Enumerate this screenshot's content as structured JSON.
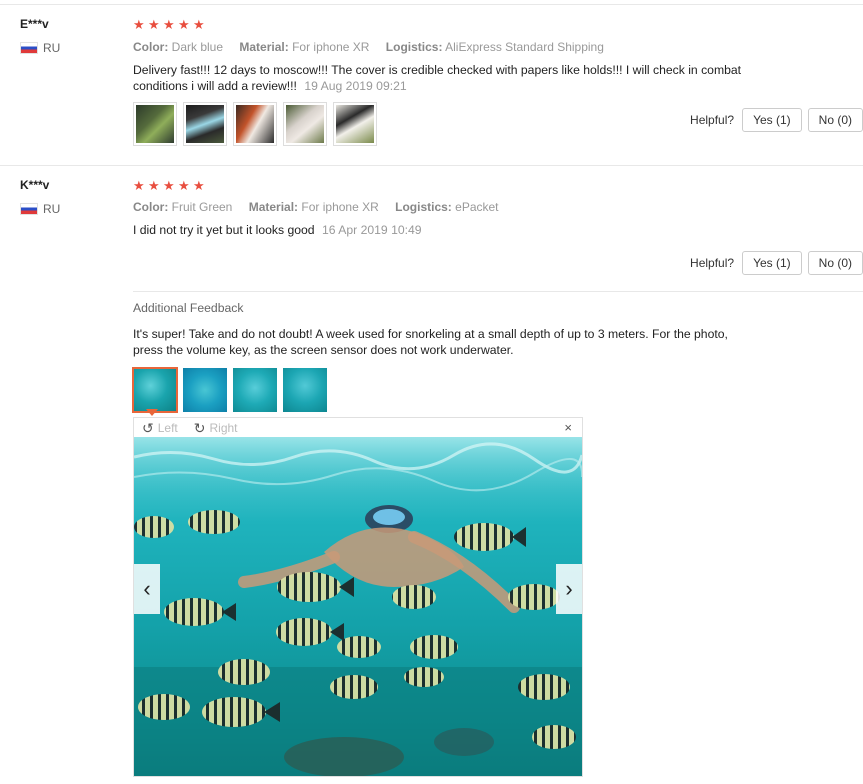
{
  "reviews": [
    {
      "user": "E***v",
      "country": "RU",
      "stars": 5,
      "attrs": {
        "color_label": "Color:",
        "color_value": "Dark blue",
        "material_label": "Material:",
        "material_value": "For iphone XR",
        "logistics_label": "Logistics:",
        "logistics_value": "AliExpress Standard Shipping"
      },
      "text": "Delivery fast!!! 12 days to moscow!!! The cover is credible checked with papers like holds!!! I will check in combat conditions i will add a review!!!",
      "date": "19 Aug 2019 09:21",
      "photos": 5,
      "helpful_label": "Helpful?",
      "yes_label": "Yes (1)",
      "no_label": "No (0)"
    },
    {
      "user": "K***v",
      "country": "RU",
      "stars": 5,
      "attrs": {
        "color_label": "Color:",
        "color_value": "Fruit Green",
        "material_label": "Material:",
        "material_value": "For iphone XR",
        "logistics_label": "Logistics:",
        "logistics_value": "ePacket"
      },
      "text": "I did not try it yet but it looks good",
      "date": "16 Apr 2019 10:49",
      "helpful_label": "Helpful?",
      "yes_label": "Yes (1)",
      "no_label": "No (0)"
    }
  ],
  "additional_feedback": {
    "title": "Additional Feedback",
    "text": "It's super! Take and do not doubt! A week used for snorkeling at a small depth of up to 3 meters. For the photo, press the volume key, as the screen sensor does not work underwater.",
    "photo_count": 4
  },
  "viewer": {
    "rotate_left_label": "Left",
    "rotate_right_label": "Right",
    "close_glyph": "×",
    "prev_glyph": "‹",
    "next_glyph": "›"
  },
  "colors": {
    "star": "#e84e3f",
    "accent": "#e8663a",
    "water": "#14a2aa"
  }
}
